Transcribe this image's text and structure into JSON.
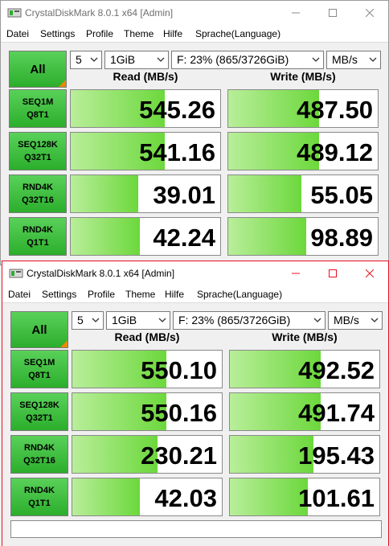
{
  "colors": {
    "accent_green": "#2cae2c",
    "bar_green": "#6cd83c",
    "active_border": "#e81123",
    "all_corner": "#e88b00"
  },
  "windows": [
    {
      "title": "CrystalDiskMark 8.0.1 x64 [Admin]",
      "menu": [
        "Datei",
        "Settings",
        "Profile",
        "Theme",
        "Hilfe",
        "Sprache(Language)"
      ],
      "all_label": "All",
      "count": "5",
      "size": "1GiB",
      "drive": "F: 23% (865/3726GiB)",
      "unit": "MB/s",
      "read_header": "Read (MB/s)",
      "write_header": "Write (MB/s)",
      "rows": [
        {
          "line1": "SEQ1M",
          "line2": "Q8T1",
          "read": "545.26",
          "write": "487.50",
          "read_fill": 0.63,
          "write_fill": 0.61
        },
        {
          "line1": "SEQ128K",
          "line2": "Q32T1",
          "read": "541.16",
          "write": "489.12",
          "read_fill": 0.63,
          "write_fill": 0.61
        },
        {
          "line1": "RND4K",
          "line2": "Q32T16",
          "read": "39.01",
          "write": "55.05",
          "read_fill": 0.45,
          "write_fill": 0.49
        },
        {
          "line1": "RND4K",
          "line2": "Q1T1",
          "read": "42.24",
          "write": "98.89",
          "read_fill": 0.46,
          "write_fill": 0.52
        }
      ]
    },
    {
      "title": "CrystalDiskMark 8.0.1 x64 [Admin]",
      "menu": [
        "Datei",
        "Settings",
        "Profile",
        "Theme",
        "Hilfe",
        "Sprache(Language)"
      ],
      "all_label": "All",
      "count": "5",
      "size": "1GiB",
      "drive": "F: 23% (865/3726GiB)",
      "unit": "MB/s",
      "read_header": "Read (MB/s)",
      "write_header": "Write (MB/s)",
      "rows": [
        {
          "line1": "SEQ1M",
          "line2": "Q8T1",
          "read": "550.10",
          "write": "492.52",
          "read_fill": 0.63,
          "write_fill": 0.61
        },
        {
          "line1": "SEQ128K",
          "line2": "Q32T1",
          "read": "550.16",
          "write": "491.74",
          "read_fill": 0.63,
          "write_fill": 0.61
        },
        {
          "line1": "RND4K",
          "line2": "Q32T16",
          "read": "230.21",
          "write": "195.43",
          "read_fill": 0.57,
          "write_fill": 0.56
        },
        {
          "line1": "RND4K",
          "line2": "Q1T1",
          "read": "42.03",
          "write": "101.61",
          "read_fill": 0.45,
          "write_fill": 0.52
        }
      ]
    }
  ]
}
